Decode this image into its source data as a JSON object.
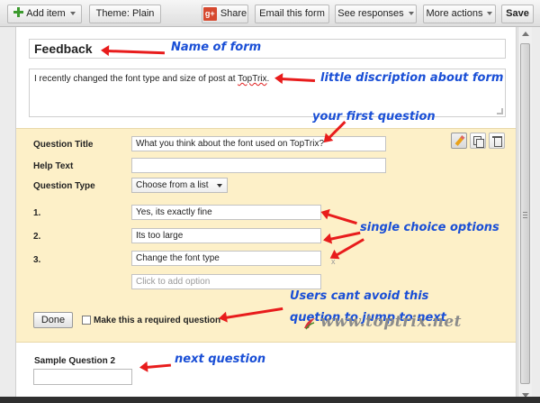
{
  "toolbar": {
    "add_item": "Add item",
    "theme": "Theme:  Plain",
    "share": "Share",
    "gplus_glyph": "g+",
    "email": "Email this form",
    "responses": "See responses",
    "more": "More actions",
    "save": "Save"
  },
  "form": {
    "title": "Feedback",
    "description_text": "I recently changed the font type and size of post at ",
    "description_link": "TopTrix"
  },
  "question": {
    "title_label": "Question Title",
    "title_value": "What you think about the font used on TopTrix?",
    "help_label": "Help Text",
    "help_value": "",
    "type_label": "Question Type",
    "type_value": "Choose from a list",
    "options": [
      {
        "num": "1.",
        "value": "Yes, its exactly fine"
      },
      {
        "num": "2.",
        "value": "Its too large"
      },
      {
        "num": "3.",
        "value": "Change the font type"
      }
    ],
    "add_option_placeholder": "Click to add option",
    "remove_glyph": "x",
    "done": "Done",
    "required_label": "Make this a required question"
  },
  "sample": {
    "label": "Sample Question 2"
  },
  "annotations": {
    "name_of_form": "Name of form",
    "description": "little discription about form",
    "first_question": "your first question",
    "options": "single choice options",
    "required_line1": "Users cant avoid this",
    "required_line2": "quetion to jump to next",
    "next_question": "next question"
  },
  "watermark": "www.toptrix.net",
  "colors": {
    "annotation_text": "#1a4fd6",
    "annotation_arrow": "#e81c1c",
    "question_block_bg": "#fdf0c8"
  }
}
